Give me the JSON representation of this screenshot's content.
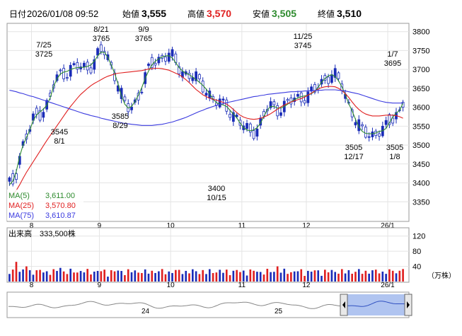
{
  "header": {
    "date_label": "日付",
    "datetime": "2026/01/08 09:52",
    "open_label": "始値",
    "open_value": "3,555",
    "high_label": "高値",
    "high_value": "3,570",
    "low_label": "安値",
    "low_value": "3,505",
    "close_label": "終値",
    "close_value": "3,510"
  },
  "ma_legend": [
    {
      "label": "MA(5)",
      "value": "3,611.00",
      "color": "#2e8b2e"
    },
    {
      "label": "MA(25)",
      "value": "3,570.80",
      "color": "#e02020"
    },
    {
      "label": "MA(75)",
      "value": "3,610.87",
      "color": "#3a3adf"
    }
  ],
  "volume_panel": {
    "title": "出来高",
    "value": "333,500株",
    "y_ticks": [
      120,
      80,
      40
    ],
    "unit": "（万株）"
  },
  "navigator": {
    "labels": [
      "24",
      "25"
    ]
  },
  "colors": {
    "up_candle": "#ffffff",
    "down_candle": "#1a2cb8",
    "volume_up": "#e02020",
    "volume_down": "#1a2cb8",
    "navigator_fill": "#b0c4f0"
  },
  "chart_data": {
    "type": "candlestick",
    "ylim": [
      3300,
      3820
    ],
    "y_ticks": [
      3800,
      3750,
      3700,
      3650,
      3600,
      3550,
      3500,
      3450,
      3400,
      3350
    ],
    "x_month_labels": [
      "8",
      "9",
      "10",
      "11",
      "12",
      "26/1"
    ],
    "annotations": [
      {
        "date": "7/25",
        "price": "3725"
      },
      {
        "date": "8/21",
        "price": "3765"
      },
      {
        "date": "9/9",
        "price": "3765"
      },
      {
        "date": "11/25",
        "price": "3745"
      },
      {
        "date": "1/7",
        "price": "3695"
      },
      {
        "date": "8/1",
        "price": "3545"
      },
      {
        "date": "8/29",
        "price": "3585"
      },
      {
        "date": "10/15",
        "price": "3400"
      },
      {
        "date": "12/17",
        "price": "3505"
      },
      {
        "date": "1/8",
        "price": "3505"
      }
    ],
    "volume_ylim": [
      0,
      140
    ],
    "series": [
      {
        "name": "MA(5)",
        "values": [
          3395,
          3405,
          3430,
          3470,
          3500,
          3520,
          3540,
          3565,
          3580,
          3588,
          3595,
          3605,
          3625,
          3655,
          3675,
          3688,
          3693,
          3695,
          3700,
          3703,
          3705,
          3705,
          3706,
          3708,
          3712,
          3722,
          3736,
          3746,
          3745,
          3732,
          3712,
          3690,
          3662,
          3630,
          3608,
          3598,
          3602,
          3615,
          3632,
          3652,
          3676,
          3696,
          3712,
          3722,
          3728,
          3733,
          3736,
          3736,
          3730,
          3718,
          3705,
          3696,
          3690,
          3686,
          3680,
          3673,
          3666,
          3658,
          3648,
          3636,
          3622,
          3612,
          3608,
          3606,
          3602,
          3592,
          3582,
          3572,
          3558,
          3546,
          3540,
          3538,
          3540,
          3546,
          3558,
          3576,
          3593,
          3602,
          3602,
          3598,
          3598,
          3602,
          3608,
          3614,
          3620,
          3625,
          3628,
          3630,
          3632,
          3636,
          3642,
          3653,
          3666,
          3676,
          3683,
          3686,
          3681,
          3670,
          3654,
          3633,
          3610,
          3590,
          3568,
          3548,
          3536,
          3531,
          3530,
          3530,
          3532,
          3536,
          3538,
          3544,
          3559,
          3574,
          3585,
          3591,
          3611
        ]
      },
      {
        "name": "MA(25)",
        "values": [
          3365,
          3370,
          3380,
          3395,
          3412,
          3428,
          3442,
          3456,
          3470,
          3484,
          3498,
          3512,
          3525,
          3538,
          3551,
          3564,
          3577,
          3590,
          3602,
          3613,
          3624,
          3634,
          3642,
          3650,
          3657,
          3663,
          3668,
          3673,
          3678,
          3682,
          3685,
          3688,
          3690,
          3691,
          3692,
          3693,
          3694,
          3695,
          3696,
          3697,
          3699,
          3701,
          3702,
          3703,
          3703,
          3702,
          3700,
          3698,
          3694,
          3690,
          3686,
          3680,
          3673,
          3665,
          3656,
          3647,
          3640,
          3633,
          3628,
          3624,
          3621,
          3619,
          3616,
          3613,
          3608,
          3602,
          3594,
          3586,
          3579,
          3574,
          3571,
          3569,
          3568,
          3569,
          3571,
          3574,
          3578,
          3583,
          3589,
          3595,
          3601,
          3606,
          3610,
          3614,
          3617,
          3620,
          3623,
          3627,
          3632,
          3637,
          3643,
          3648,
          3652,
          3654,
          3655,
          3655,
          3654,
          3650,
          3644,
          3636,
          3626,
          3614,
          3603,
          3594,
          3587,
          3582,
          3579,
          3577,
          3577,
          3577,
          3578,
          3579,
          3579,
          3579,
          3578,
          3575,
          3571
        ]
      },
      {
        "name": "MA(75)",
        "values": [
          3645,
          3643,
          3641,
          3638,
          3636,
          3633,
          3630,
          3628,
          3625,
          3622,
          3619,
          3616,
          3613,
          3610,
          3607,
          3604,
          3601,
          3598,
          3595,
          3592,
          3589,
          3586,
          3583,
          3581,
          3578,
          3576,
          3574,
          3571,
          3569,
          3567,
          3565,
          3563,
          3561,
          3559,
          3557,
          3556,
          3555,
          3554,
          3553,
          3552,
          3552,
          3552,
          3552,
          3553,
          3554,
          3555,
          3557,
          3559,
          3561,
          3564,
          3567,
          3570,
          3573,
          3577,
          3581,
          3585,
          3589,
          3592,
          3596,
          3599,
          3602,
          3605,
          3607,
          3610,
          3612,
          3614,
          3616,
          3618,
          3620,
          3622,
          3624,
          3626,
          3628,
          3629,
          3631,
          3632,
          3634,
          3635,
          3636,
          3637,
          3638,
          3639,
          3640,
          3641,
          3641,
          3642,
          3642,
          3643,
          3643,
          3644,
          3644,
          3645,
          3645,
          3646,
          3646,
          3646,
          3646,
          3645,
          3644,
          3643,
          3641,
          3639,
          3637,
          3635,
          3632,
          3629,
          3626,
          3623,
          3620,
          3617,
          3615,
          3613,
          3612,
          3611,
          3611,
          3611,
          3611
        ]
      }
    ]
  }
}
